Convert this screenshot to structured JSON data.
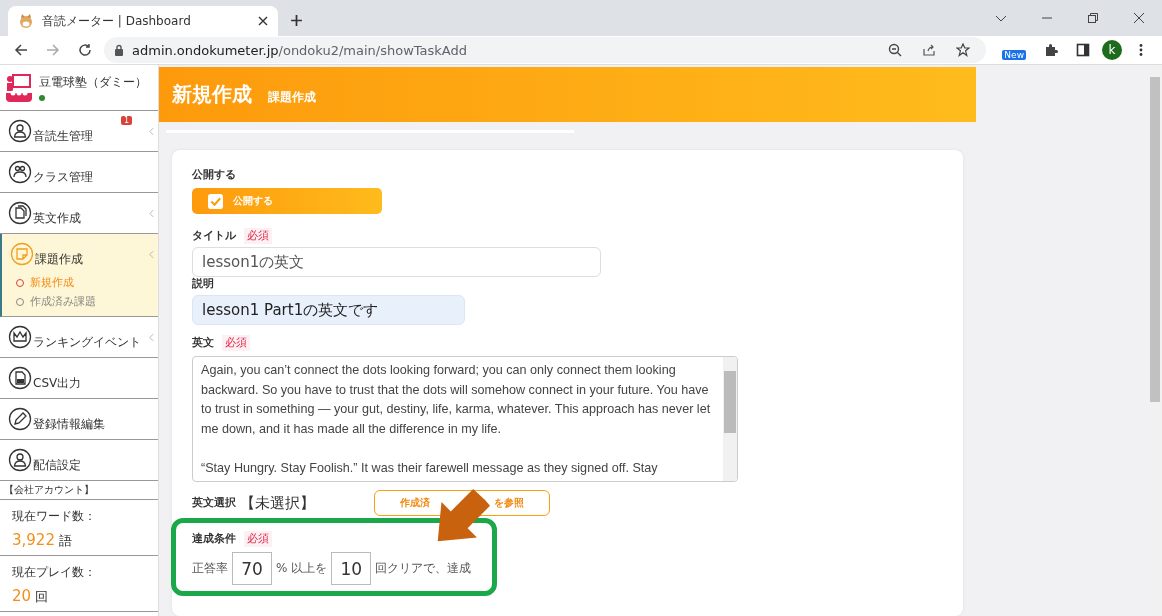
{
  "browser": {
    "tab_title": "音読メーター | Dashboard",
    "url_host": "admin.ondokumeter.jp",
    "url_path": "/ondoku2/main/showTaskAdd",
    "extension_badge": "New",
    "profile_initial": "k"
  },
  "sidebar": {
    "school": "豆電球塾（ダミー）",
    "online": true,
    "items": [
      {
        "label": "音読生管理",
        "kind": "person",
        "badge": "1",
        "chevron": true,
        "selected": false
      },
      {
        "label": "クラス管理",
        "kind": "group",
        "chevron": false,
        "selected": false
      },
      {
        "label": "英文作成",
        "kind": "document",
        "chevron": true,
        "selected": false
      },
      {
        "label": "課題作成",
        "kind": "note",
        "chevron": true,
        "selected": true,
        "children": [
          {
            "label": "新規作成",
            "selected": true
          },
          {
            "label": "作成済み課題",
            "selected": false
          }
        ]
      },
      {
        "label": "ランキングイベント",
        "kind": "crown",
        "chevron": true,
        "selected": false
      },
      {
        "label": "CSV出力",
        "kind": "file",
        "chevron": false,
        "selected": false
      },
      {
        "label": "登録情報編集",
        "kind": "pencil",
        "chevron": false,
        "selected": false
      },
      {
        "label": "配信設定",
        "kind": "person",
        "chevron": false,
        "selected": false
      }
    ],
    "account_title": "【会社アカウント】",
    "stats": [
      {
        "label": "現在ワード数：",
        "value": "3,922",
        "unit": "語"
      },
      {
        "label": "現在プレイ数：",
        "value": "20",
        "unit": "回"
      }
    ]
  },
  "header": {
    "title": "新規作成",
    "subtitle": "課題作成"
  },
  "form": {
    "publish_label": "公開する",
    "publish_toggle": {
      "label": "公開する",
      "checked": true
    },
    "title_label": "タイトル",
    "title_required": "必須",
    "title_value": "lesson1の英文",
    "description_label": "説明",
    "description_value": "lesson1 Part1の英文です",
    "text_label": "英文",
    "text_required": "必須",
    "text_paragraphs": [
      "Again, you can’t connect the dots looking forward; you can only connect them looking backward. So you have to trust that the dots will somehow connect in your future. You have to trust in something — your gut, destiny, life, karma, whatever. This approach has never let me down, and it has made all the difference in my life.",
      "“Stay Hungry. Stay Foolish.” It was their farewell message as they signed off. Stay"
    ],
    "select_label": "英文選択",
    "select_value": "【未選択】",
    "browse_button": {
      "label_start": "作成済",
      "label_end": "を参照"
    },
    "goal_label": "達成条件",
    "goal_required": "必須",
    "goal": {
      "prefix": "正答率",
      "rate": "70",
      "middle": "% 以上を",
      "count": "10",
      "suffix": "回クリアで、達成"
    }
  }
}
